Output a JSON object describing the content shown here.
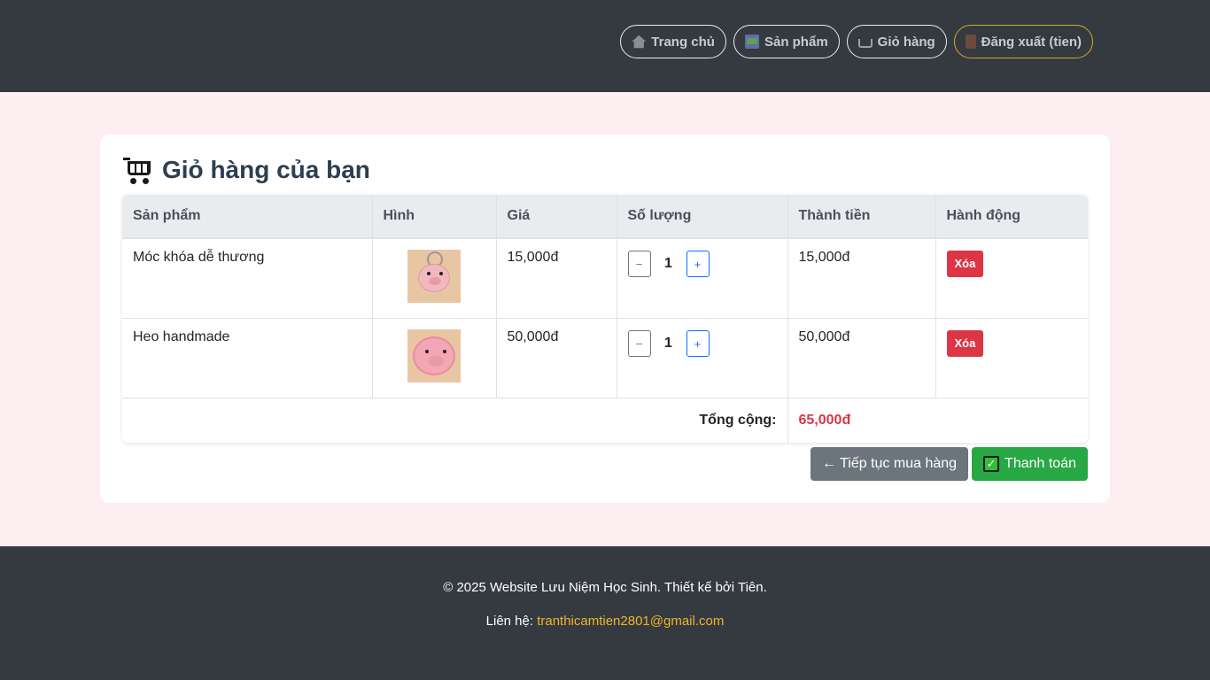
{
  "nav": {
    "home": "Trang chủ",
    "products": "Sản phẩm",
    "cart": "Giỏ hàng",
    "logout": "Đăng xuất (tien)"
  },
  "cart": {
    "title": "Giỏ hàng của bạn",
    "headers": [
      "Sản phẩm",
      "Hình",
      "Giá",
      "Số lượng",
      "Thành tiền",
      "Hành động"
    ],
    "items": [
      {
        "name": "Móc khóa dễ thương",
        "price": "15,000đ",
        "qty": "1",
        "subtotal": "15,000đ",
        "delete": "Xóa"
      },
      {
        "name": "Heo handmade",
        "price": "50,000đ",
        "qty": "1",
        "subtotal": "50,000đ",
        "delete": "Xóa"
      }
    ],
    "total_label": "Tổng cộng:",
    "total_value": "65,000đ",
    "minus": "−",
    "plus": "+",
    "continue": "← Tiếp tục mua hàng",
    "checkout": "Thanh toán"
  },
  "footer": {
    "copyright": "© 2025 Website Lưu Niệm Học Sinh. Thiết kế bởi Tiên.",
    "contact_label": "Liên hệ: ",
    "email": "tranthicamtien2801@gmail.com"
  }
}
